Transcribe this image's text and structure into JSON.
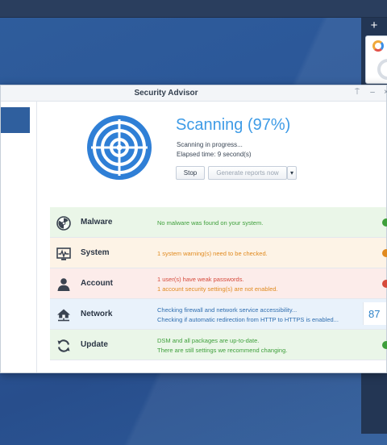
{
  "colors": {
    "accent": "#3e9be6",
    "ok": "#3e9f3b",
    "warning": "#e08a1f",
    "danger": "#d64a3b",
    "info": "#2f6eb0",
    "row_ok_bg": "#eaf6e8",
    "row_warn_bg": "#fdf3e6",
    "row_danger_bg": "#fcecea",
    "row_info_bg": "#e9f2fb"
  },
  "desktop": {
    "add_widget_label": "+"
  },
  "window": {
    "title": "Security Advisor",
    "pin_label": "⍑",
    "minimize_label": "–",
    "close_label": "×"
  },
  "scan": {
    "title": "Scanning (97%)",
    "progress_percent": 97,
    "status_line": "Scanning in progress...",
    "elapsed_line": "Elapsed time: 9 second(s)",
    "stop_label": "Stop",
    "generate_label": "Generate reports now",
    "dropdown_label": "▾"
  },
  "categories": [
    {
      "key": "malware",
      "icon": "radiation-icon",
      "label": "Malware",
      "state": "ok",
      "messages": [
        "No malware was found on your system."
      ]
    },
    {
      "key": "system",
      "icon": "monitor-pulse-icon",
      "label": "System",
      "state": "warning",
      "messages": [
        "1 system warning(s) need to be checked."
      ]
    },
    {
      "key": "account",
      "icon": "user-icon",
      "label": "Account",
      "state": "danger",
      "messages": [
        "1 user(s) have weak passwords.",
        "1 account security setting(s) are not enabled."
      ]
    },
    {
      "key": "network",
      "icon": "house-network-icon",
      "label": "Network",
      "state": "scanning",
      "messages": [
        "Checking firewall and network service accessibility...",
        "Checking if automatic redirection from HTTP to HTTPS is enabled..."
      ],
      "progress_text": "87"
    },
    {
      "key": "update",
      "icon": "refresh-icon",
      "label": "Update",
      "state": "ok",
      "messages": [
        "DSM and all packages are up-to-date.",
        "There are still settings we recommend changing."
      ]
    }
  ]
}
